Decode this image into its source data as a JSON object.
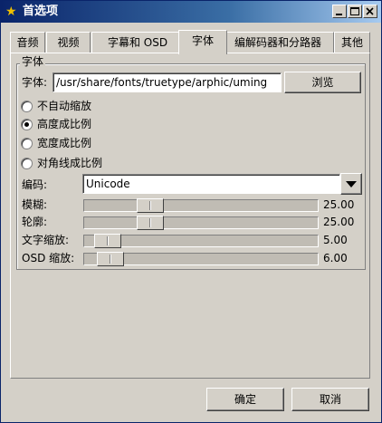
{
  "window": {
    "title": "首选项",
    "icon": "star-icon"
  },
  "tabs": [
    {
      "label": "音频",
      "active": false
    },
    {
      "label": "视频",
      "active": false
    },
    {
      "label": "字幕和 OSD",
      "active": false
    },
    {
      "label": "字体",
      "active": true
    },
    {
      "label": "编解码器和分路器",
      "active": false
    },
    {
      "label": "其他",
      "active": false
    }
  ],
  "font_group": {
    "title": "字体",
    "font_label": "字体:",
    "font_path": "/usr/share/fonts/truetype/arphic/uming",
    "browse_label": "浏览",
    "scaling_options": [
      {
        "label": "不自动缩放",
        "checked": false
      },
      {
        "label": "高度成比例",
        "checked": true
      },
      {
        "label": "宽度成比例",
        "checked": false
      },
      {
        "label": "对角线成比例",
        "checked": false
      }
    ],
    "encoding_label": "编码:",
    "encoding_value": "Unicode",
    "sliders": [
      {
        "label": "模糊:",
        "value": "25.00",
        "fraction": 0.25
      },
      {
        "label": "轮廓:",
        "value": "25.00",
        "fraction": 0.25
      },
      {
        "label": "文字缩放:",
        "value": "5.00",
        "fraction": 0.05
      },
      {
        "label": "OSD 缩放:",
        "value": "6.00",
        "fraction": 0.06
      }
    ]
  },
  "footer": {
    "ok_label": "确定",
    "cancel_label": "取消"
  }
}
